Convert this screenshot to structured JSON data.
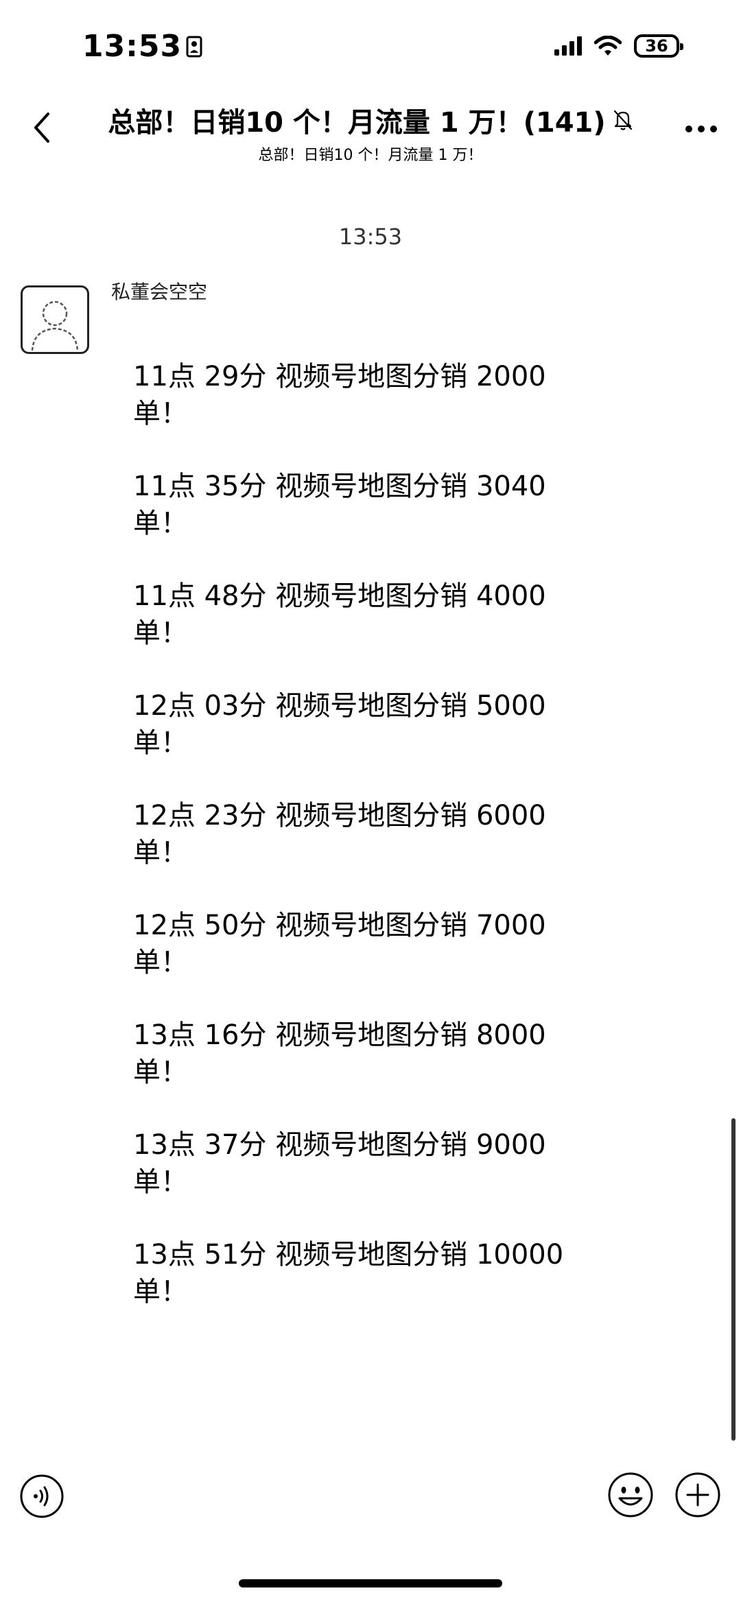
{
  "status_bar": {
    "time": "13:53",
    "battery_level": "36"
  },
  "nav": {
    "title": "总部！日销10 个！月流量 1 万！(141)",
    "subtitle": "总部！日销10 个！月流量 1 万！",
    "muted_icon": "bell-slash-icon"
  },
  "chat": {
    "timestamp": "13:53",
    "sender": "私董会空空",
    "messages": [
      "11点 29分 视频号地图分销 2000单！",
      "11点 35分 视频号地图分销 3040单！",
      "11点 48分 视频号地图分销 4000单！",
      "12点 03分 视频号地图分销 5000单！",
      "12点 23分 视频号地图分销 6000单！",
      "12点 50分 视频号地图分销 7000单！",
      "13点 16分 视频号地图分销 8000单！",
      "13点 37分 视频号地图分销 9000单！",
      "13点 51分 视频号地图分销 10000单！"
    ]
  },
  "input_bar": {
    "voice_icon": "voice-icon",
    "emoji_icon": "emoji-icon",
    "add_icon": "plus-circle-icon"
  }
}
